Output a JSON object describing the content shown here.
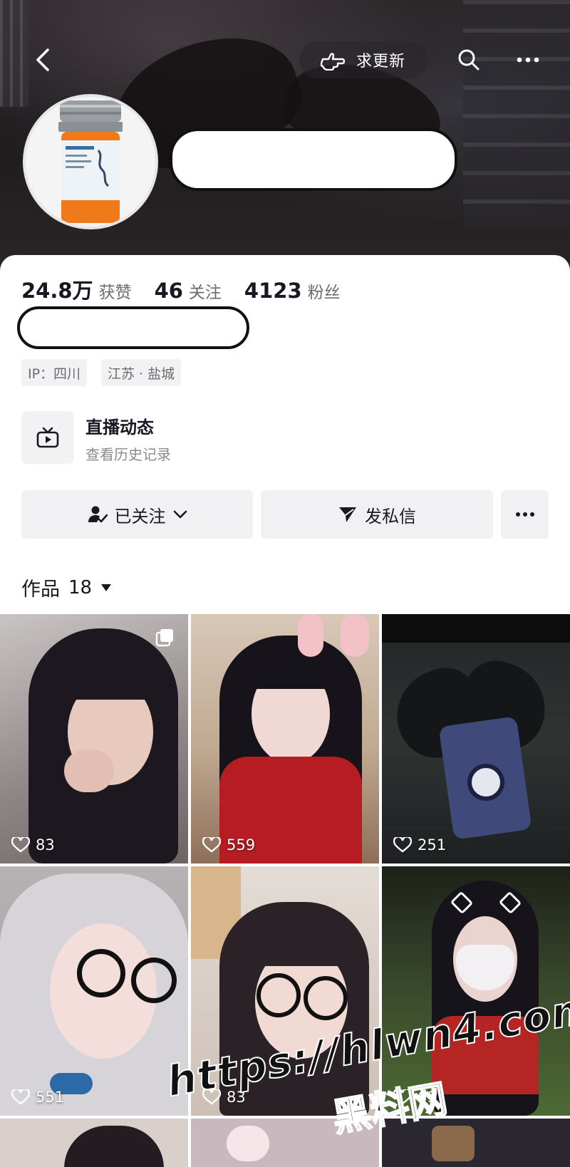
{
  "header": {
    "update_label": "求更新",
    "icons": {
      "back": "chevron-left-icon",
      "update": "pointing-hand-icon",
      "search": "search-icon",
      "more": "more-dots-icon"
    }
  },
  "profile": {
    "stats": [
      {
        "value": "24.8万",
        "label": "获赞"
      },
      {
        "value": "46",
        "label": "关注"
      },
      {
        "value": "4123",
        "label": "粉丝"
      }
    ],
    "tags": [
      "IP：四川",
      "江苏 · 盐城"
    ],
    "live": {
      "title": "直播动态",
      "subtitle": "查看历史记录"
    }
  },
  "actions": {
    "follow_label": "已关注",
    "message_label": "发私信"
  },
  "works": {
    "label": "作品",
    "count": "18"
  },
  "grid": [
    {
      "likes": "83"
    },
    {
      "likes": "559"
    },
    {
      "likes": "251"
    },
    {
      "likes": "551"
    },
    {
      "likes": "83"
    },
    {
      "likes": "69"
    }
  ],
  "watermark": {
    "url": "https://hlwn4.com",
    "name": "黑料网"
  },
  "colors": {
    "text": "#161823",
    "muted": "#6b6c72",
    "button_bg": "#f1f1f3"
  }
}
